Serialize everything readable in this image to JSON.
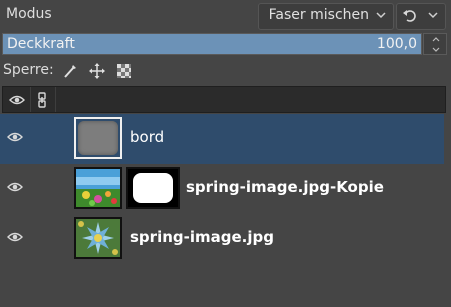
{
  "mode": {
    "label": "Modus",
    "value": "Faser mischen"
  },
  "opacity": {
    "label": "Deckkraft",
    "value": "100,0",
    "fraction": 1.0
  },
  "lock": {
    "label": "Sperre:"
  },
  "layers": [
    {
      "name": "bord",
      "selected": true
    },
    {
      "name": "spring-image.jpg-Kopie",
      "selected": false
    },
    {
      "name": "spring-image.jpg",
      "selected": false
    }
  ],
  "colors": {
    "selected_row": "#2f4c6c",
    "opacity_fill": "#6c92b7",
    "panel_bg": "#454545"
  }
}
